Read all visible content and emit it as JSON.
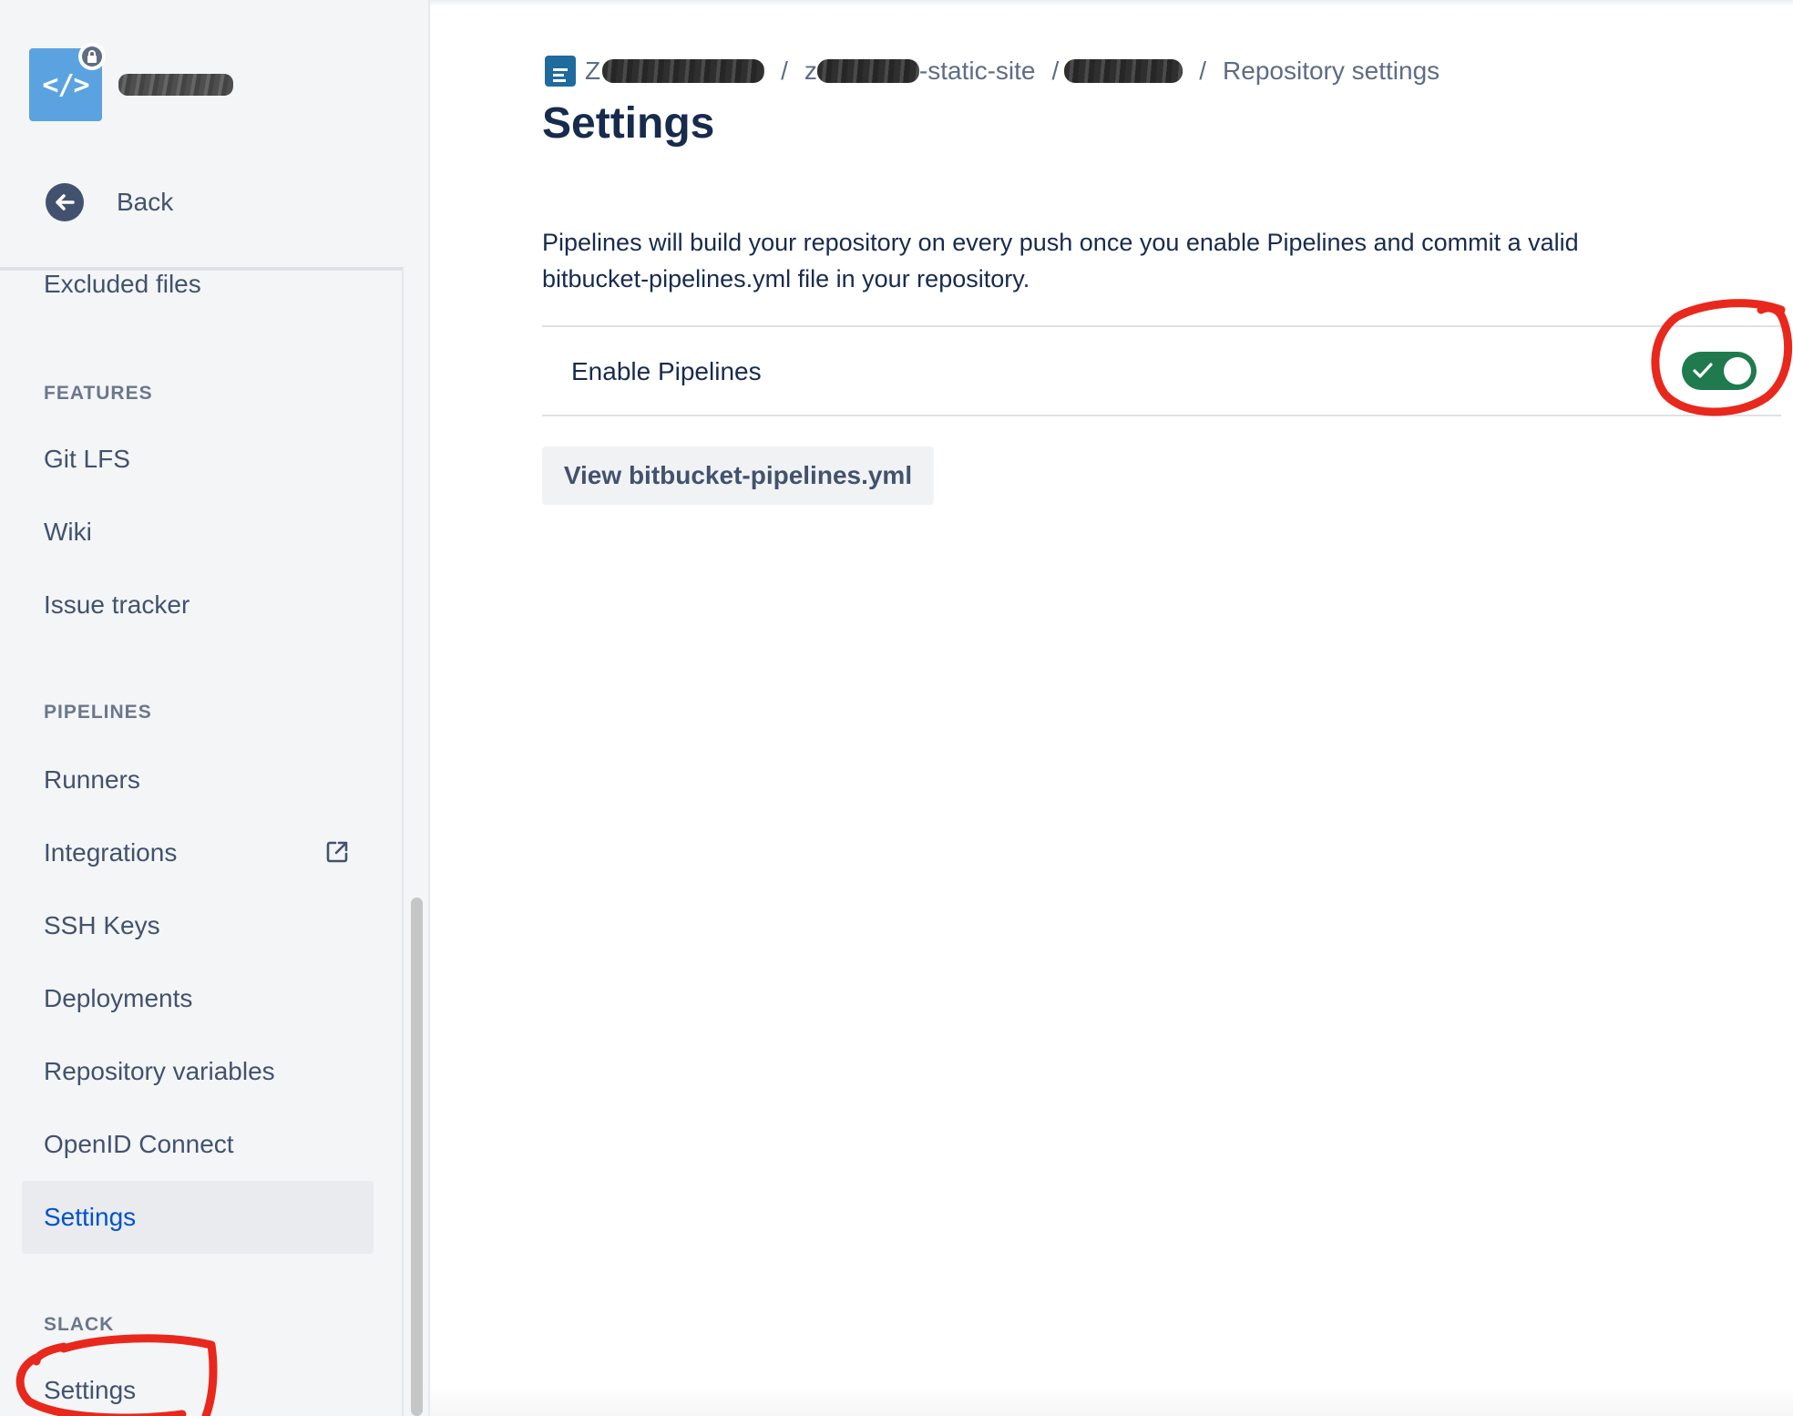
{
  "sidebar": {
    "back_label": "Back",
    "items_top": [
      {
        "label": "Excluded files"
      }
    ],
    "sections": {
      "features": {
        "title": "FEATURES",
        "items": [
          "Git LFS",
          "Wiki",
          "Issue tracker"
        ]
      },
      "pipelines": {
        "title": "PIPELINES",
        "items": [
          "Runners",
          "Integrations",
          "SSH Keys",
          "Deployments",
          "Repository variables",
          "OpenID Connect",
          "Settings"
        ],
        "selected": "Settings"
      },
      "slack": {
        "title": "SLACK",
        "items": [
          "Settings"
        ]
      }
    }
  },
  "breadcrumb": {
    "repo_suffix": "-static-site",
    "repo_prefix_visible": "z",
    "workspace_prefix_visible": "Z",
    "separator": "/",
    "current": "Repository settings"
  },
  "main": {
    "title": "Settings",
    "description": "Pipelines will build your repository on every push once you enable Pipelines and commit a valid bitbucket-pipelines.yml file in your repository.",
    "toggle_label": "Enable Pipelines",
    "toggle_enabled": true,
    "view_button_label": "View bitbucket-pipelines.yml"
  },
  "colors": {
    "accent_link": "#0052cc",
    "toggle_on": "#1f7a4d",
    "annotation": "#e8281c",
    "sidebar_bg": "#f4f5f7"
  },
  "icons": {
    "repo_avatar": "code-icon",
    "lock": "lock-icon",
    "back": "arrow-left-icon",
    "external": "external-link-icon",
    "breadcrumb_workspace": "workspace-icon",
    "toggle_check": "check-icon"
  }
}
